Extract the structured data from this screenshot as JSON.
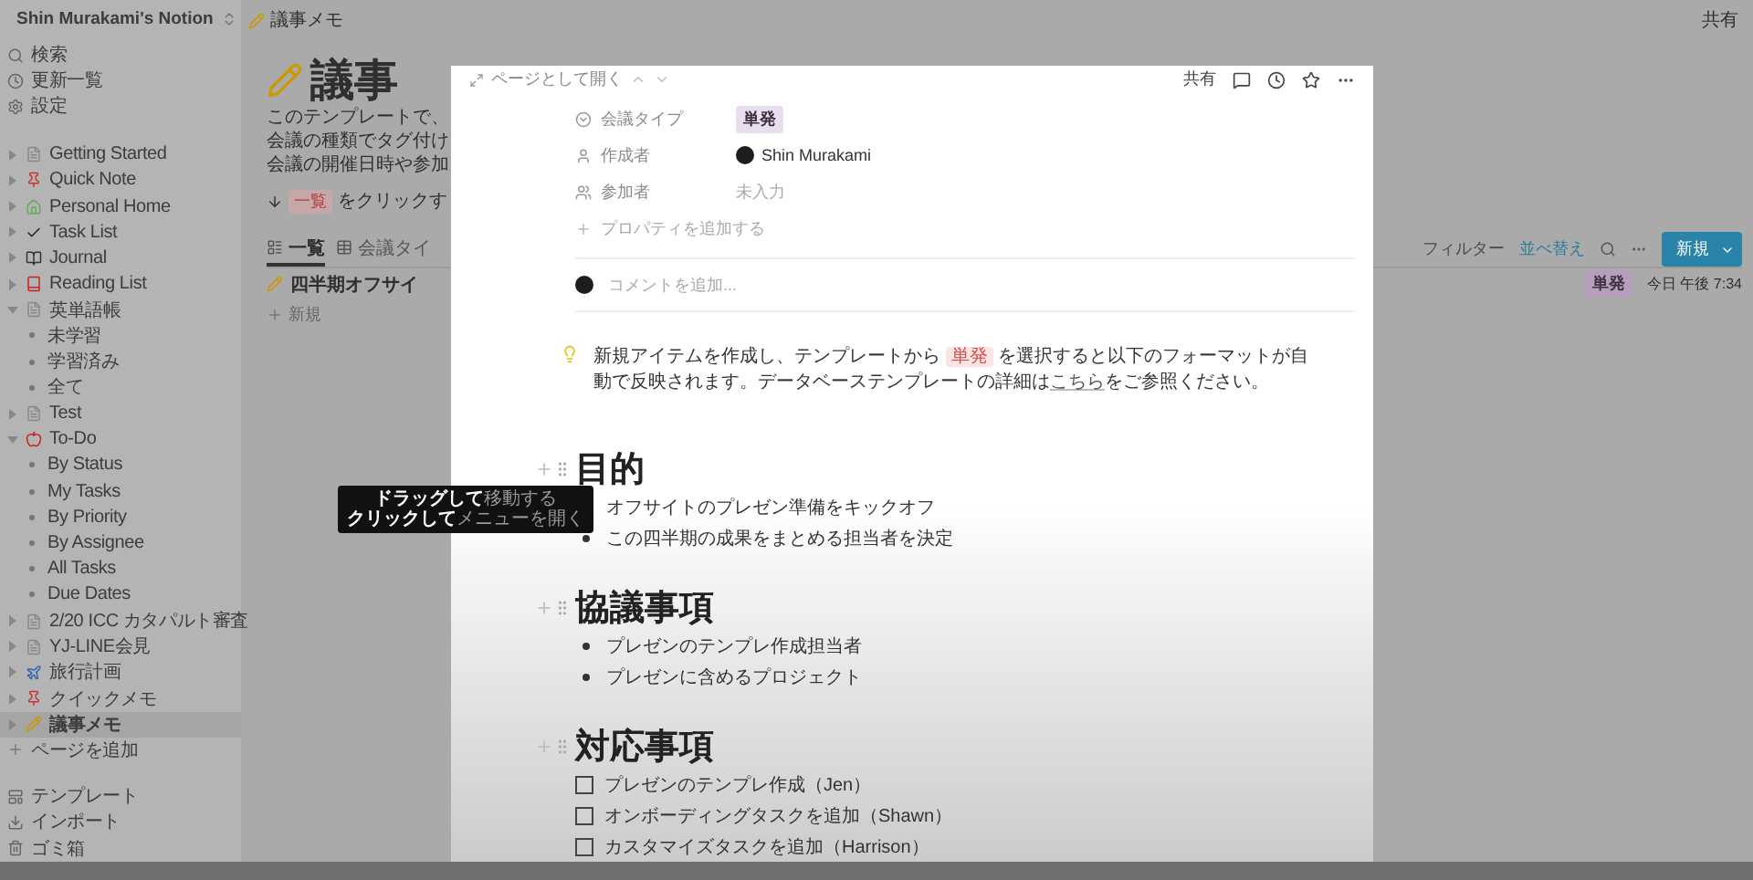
{
  "workspace": {
    "name": "Shin Murakami's Notion"
  },
  "topbar": {
    "breadcrumb": "議事メモ",
    "share": "共有"
  },
  "sidebar": {
    "actions": [
      "検索",
      "更新一覧",
      "設定"
    ],
    "pages": [
      {
        "label": "Getting Started",
        "expanded": false,
        "selected": false
      },
      {
        "label": "Quick Note",
        "expanded": false,
        "selected": false
      },
      {
        "label": "Personal Home",
        "expanded": false,
        "selected": false
      },
      {
        "label": "Task List",
        "expanded": false,
        "selected": false
      },
      {
        "label": "Journal",
        "expanded": false,
        "selected": false
      },
      {
        "label": "Reading List",
        "expanded": false,
        "selected": false
      },
      {
        "label": "英単語帳",
        "expanded": true,
        "selected": false,
        "children": [
          {
            "label": "未学習",
            "selected": false
          },
          {
            "label": "学習済み",
            "selected": false
          },
          {
            "label": "全て",
            "selected": false
          }
        ]
      },
      {
        "label": "Test",
        "expanded": false,
        "selected": false
      },
      {
        "label": "To-Do",
        "expanded": true,
        "selected": false,
        "children": [
          {
            "label": "By Status",
            "selected": false
          },
          {
            "label": "My Tasks",
            "selected": false
          },
          {
            "label": "By Priority",
            "selected": false
          },
          {
            "label": "By Assignee",
            "selected": false
          },
          {
            "label": "All Tasks",
            "selected": false
          },
          {
            "label": "Due Dates",
            "selected": false
          }
        ]
      },
      {
        "label": "2/20 ICC カタパルト審査",
        "expanded": false,
        "selected": false
      },
      {
        "label": "YJ-LINE会見",
        "expanded": false,
        "selected": false
      },
      {
        "label": "旅行計画",
        "expanded": false,
        "selected": false
      },
      {
        "label": "クイックメモ",
        "expanded": false,
        "selected": false
      },
      {
        "label": "議事メモ",
        "expanded": false,
        "selected": true
      }
    ],
    "add_page": "ページを追加",
    "footer": [
      "テンプレート",
      "インポート",
      "ゴミ箱"
    ]
  },
  "page": {
    "title": "議事",
    "description": [
      "このテンプレートで、",
      "会議の種類でタグ付け",
      "会議の開催日時や参加"
    ],
    "hint": {
      "code": "一覧",
      "text": "をクリックす"
    },
    "views": [
      {
        "label": "一覧",
        "selected": true
      },
      {
        "label": "会議タイ",
        "selected": false
      }
    ],
    "toolbar": {
      "filter": "フィルター",
      "sort": "並べ替え",
      "new": "新規"
    },
    "rows": [
      {
        "title": "四半期オフサイ",
        "tag": "単発",
        "date": "今日 午後 7:34"
      }
    ],
    "add_row": "新規"
  },
  "peek": {
    "open_as_page": "ページとして開く",
    "share": "共有",
    "properties": [
      {
        "kind": "tag",
        "name": "会議タイプ",
        "value": "単発"
      },
      {
        "kind": "person",
        "name": "作成者",
        "value": "Shin Murakami"
      },
      {
        "kind": "empty",
        "name": "参加者",
        "value": "未入力"
      }
    ],
    "add_property": "プロパティを追加する",
    "comment_placeholder": "コメントを追加...",
    "callout": [
      {
        "kind": "text",
        "text": "新規アイテムを作成し、テンプレートから "
      },
      {
        "kind": "code",
        "text": "単発"
      },
      {
        "kind": "text",
        "text": " を選択すると以下のフォーマットが自動で反映されます。データベーステンプレートの詳細は"
      },
      {
        "kind": "link",
        "text": "こちら"
      },
      {
        "kind": "text",
        "text": "をご参照ください。"
      }
    ],
    "blocks": [
      {
        "kind": "heading",
        "text": "目的",
        "tooltip": [
          "**ドラッグして**移動する",
          "**クリックして**メニューを開く"
        ]
      },
      {
        "kind": "bullet",
        "text": "オフサイトのプレゼン準備をキックオフ"
      },
      {
        "kind": "bullet",
        "text": "この四半期の成果をまとめる担当者を決定"
      },
      {
        "kind": "heading",
        "text": "協議事項"
      },
      {
        "kind": "bullet",
        "text": "プレゼンのテンプレ作成担当者"
      },
      {
        "kind": "bullet",
        "text": "プレゼンに含めるプロジェクト"
      },
      {
        "kind": "heading",
        "text": "対応事項"
      },
      {
        "kind": "todo",
        "text": "プレゼンのテンプレ作成（Jen）",
        "checked": false
      },
      {
        "kind": "todo",
        "text": "オンボーディングタスクを追加（Shawn）",
        "checked": false
      },
      {
        "kind": "todo",
        "text": "カスタマイズタスクを追加（Harrison）",
        "checked": false
      }
    ]
  }
}
